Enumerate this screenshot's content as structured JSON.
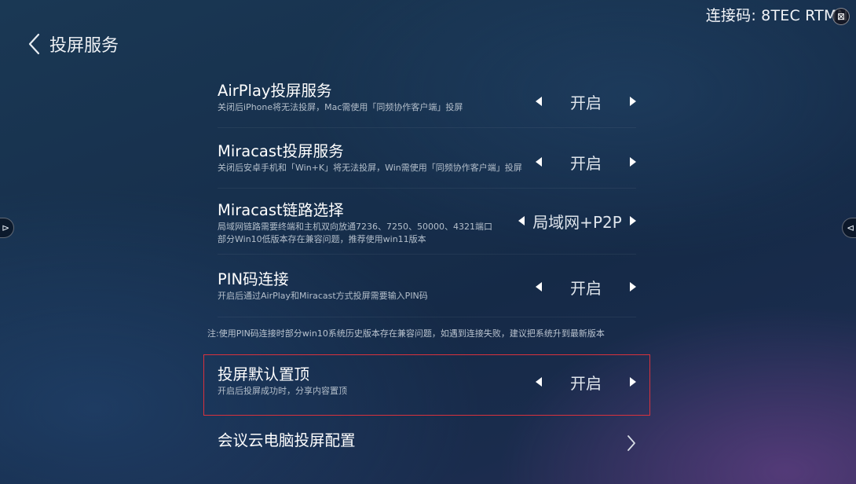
{
  "header": {
    "title": "投屏服务"
  },
  "connection": {
    "code_text": "连接码: 8TEC RTMN"
  },
  "settings": [
    {
      "title": "AirPlay投屏服务",
      "desc": [
        "关闭后iPhone将无法投屏，Mac需使用「同频协作客户端」投屏"
      ],
      "value": "开启"
    },
    {
      "title": "Miracast投屏服务",
      "desc": [
        "关闭后安卓手机和「Win+K」将无法投屏，Win需使用「同频协作客户端」投屏"
      ],
      "value": "开启"
    },
    {
      "title": "Miracast链路选择",
      "desc": [
        "局域网链路需要终端和主机双向放通7236、7250、50000、4321端口",
        "部分Win10低版本存在兼容问题，推荐使用win11版本"
      ],
      "value": "局域网+P2P"
    },
    {
      "title": "PIN码连接",
      "desc": [
        "开启后通过AirPlay和Miracast方式投屏需要输入PIN码"
      ],
      "value": "开启"
    },
    {
      "title": "投屏默认置顶",
      "desc": [
        "开启后投屏成功时，分享内容置顶"
      ],
      "value": "开启"
    }
  ],
  "note": "注:使用PIN码连接时部分win10系统历史版本存在兼容问题，如遇到连接失败，建议把系统升到最新版本",
  "cloud_config": {
    "title": "会议云电脑投屏配置"
  },
  "colors": {
    "highlight_border": "#d9323d",
    "background": "#17304d"
  }
}
